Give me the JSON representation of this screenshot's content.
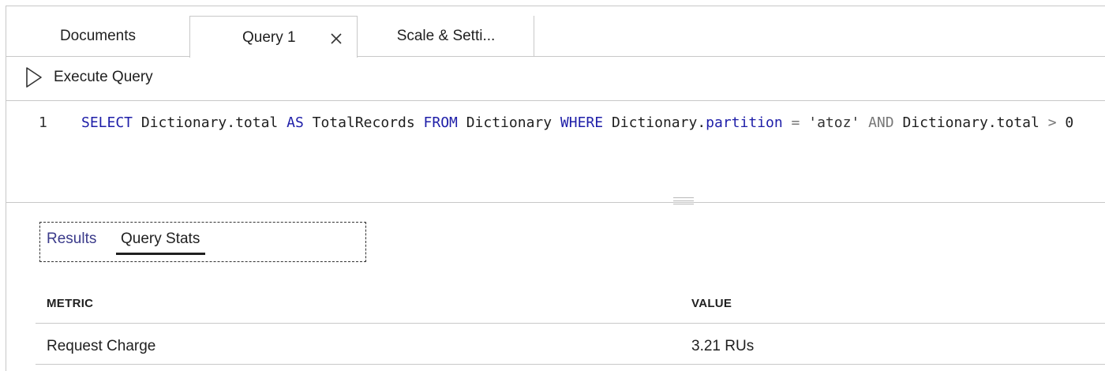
{
  "tabs": [
    {
      "label": "Documents"
    },
    {
      "label": "Query 1"
    },
    {
      "label": "Scale & Setti..."
    }
  ],
  "toolbar": {
    "execute_label": "Execute Query"
  },
  "editor": {
    "line_number": "1",
    "tokens": {
      "t1": "SELECT",
      "t2": " Dictionary.total ",
      "t3": "AS",
      "t4": " TotalRecords ",
      "t5": "FROM",
      "t6": " Dictionary ",
      "t7": "WHERE",
      "t8": " Dictionary.",
      "t9": "partition",
      "t10": " ",
      "t11": "=",
      "t12": " 'atoz' ",
      "t13": "AND",
      "t14": " Dictionary.total ",
      "t15": ">",
      "t16": " 0"
    }
  },
  "results_tabs": {
    "results_label": "Results",
    "stats_label": "Query Stats",
    "active": "Query Stats"
  },
  "stats": {
    "headers": {
      "metric": "METRIC",
      "value": "VALUE"
    },
    "rows": [
      {
        "metric": "Request Charge",
        "value": "3.21 RUs"
      }
    ]
  },
  "colors": {
    "keyword": "#1e1ea8",
    "operator": "#777777",
    "border": "#c8c8c8",
    "results_tab": "#3a3a8a"
  },
  "icons": {
    "execute": "play-icon",
    "close": "close-icon"
  }
}
